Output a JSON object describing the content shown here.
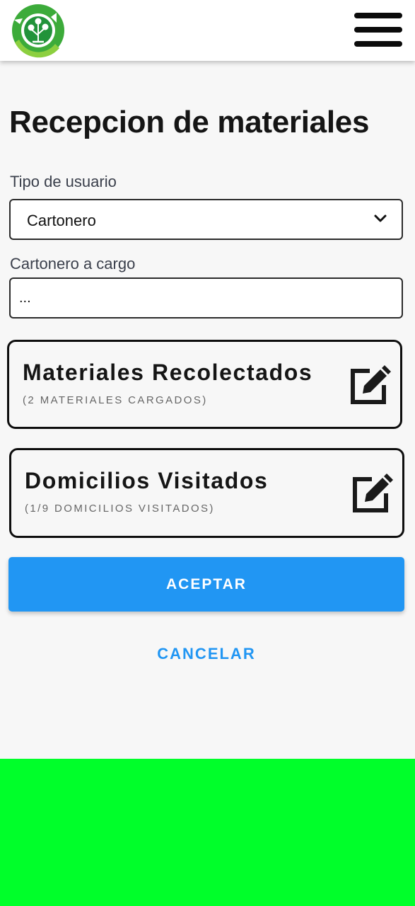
{
  "header": {
    "logo_icon": "recycling-tree-logo",
    "menu_icon": "hamburger-menu-icon"
  },
  "page": {
    "title": "Recepcion de materiales"
  },
  "form": {
    "user_type": {
      "label": "Tipo de usuario",
      "value": "Cartonero"
    },
    "cartonero": {
      "label": "Cartonero a cargo",
      "value": "..."
    }
  },
  "cards": {
    "materials": {
      "title": "Materiales Recolectados",
      "subtitle": "(2 MATERIALES CARGADOS)",
      "icon": "edit-icon"
    },
    "homes": {
      "title": "Domicilios Visitados",
      "subtitle": "(1/9 DOMICILIOS VISITADOS)",
      "icon": "edit-icon"
    }
  },
  "actions": {
    "accept_label": "ACEPTAR",
    "cancel_label": "CANCELAR"
  },
  "colors": {
    "accent_blue": "#2196f3",
    "logo_green": "#3cab3a",
    "bottom_block_green": "#00ff2a"
  }
}
